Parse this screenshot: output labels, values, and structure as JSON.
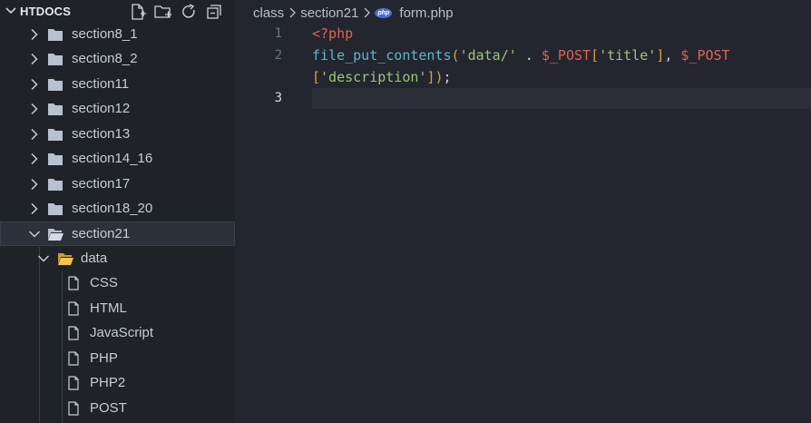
{
  "explorer": {
    "title": "HTDOCS",
    "actions": [
      "new-file-icon",
      "new-folder-icon",
      "refresh-icon",
      "collapse-all-icon"
    ],
    "items": [
      {
        "label": "section8_1",
        "type": "folder",
        "expanded": false
      },
      {
        "label": "section8_2",
        "type": "folder",
        "expanded": false
      },
      {
        "label": "section11",
        "type": "folder",
        "expanded": false
      },
      {
        "label": "section12",
        "type": "folder",
        "expanded": false
      },
      {
        "label": "section13",
        "type": "folder",
        "expanded": false
      },
      {
        "label": "section14_16",
        "type": "folder",
        "expanded": false
      },
      {
        "label": "section17",
        "type": "folder",
        "expanded": false
      },
      {
        "label": "section18_20",
        "type": "folder",
        "expanded": false
      },
      {
        "label": "section21",
        "type": "folder",
        "expanded": true,
        "selected": true
      },
      {
        "label": "data",
        "type": "folder",
        "expanded": true
      },
      {
        "label": "CSS",
        "type": "file"
      },
      {
        "label": "HTML",
        "type": "file"
      },
      {
        "label": "JavaScript",
        "type": "file"
      },
      {
        "label": "PHP",
        "type": "file"
      },
      {
        "label": "PHP2",
        "type": "file"
      },
      {
        "label": "POST",
        "type": "file"
      }
    ]
  },
  "breadcrumb": {
    "parts": [
      "class",
      "section21"
    ],
    "file_icon": "php-file-icon",
    "file_icon_text": "php",
    "file": "form.php"
  },
  "editor": {
    "line_numbers": [
      "1",
      "2",
      "",
      "3"
    ],
    "lines": [
      [
        {
          "t": "<?php",
          "c": "t-tag"
        }
      ],
      [
        {
          "t": "file_put_contents",
          "c": "t-fn"
        },
        {
          "t": "(",
          "c": "t-br"
        },
        {
          "t": "'data/'",
          "c": "t-str"
        },
        {
          "t": " . ",
          "c": "t-pun"
        },
        {
          "t": "$_POST",
          "c": "t-var"
        },
        {
          "t": "[",
          "c": "t-br"
        },
        {
          "t": "'title'",
          "c": "t-str"
        },
        {
          "t": "]",
          "c": "t-br"
        },
        {
          "t": ", ",
          "c": "t-pun"
        },
        {
          "t": "$_POST",
          "c": "t-var"
        }
      ],
      [
        {
          "t": "[",
          "c": "t-br"
        },
        {
          "t": "'description'",
          "c": "t-str"
        },
        {
          "t": "]",
          "c": "t-br"
        },
        {
          "t": ")",
          "c": "t-br"
        },
        {
          "t": ";",
          "c": "t-pun"
        }
      ],
      []
    ]
  },
  "colors": {
    "sidebar_bg": "#1f2229",
    "editor_bg": "#23262e",
    "folder_icon": "#b8c1d0",
    "open_folder_icon": "#e0b84a",
    "keyword": "#e0624f",
    "function": "#5fb6c8",
    "string": "#9ec47a"
  }
}
